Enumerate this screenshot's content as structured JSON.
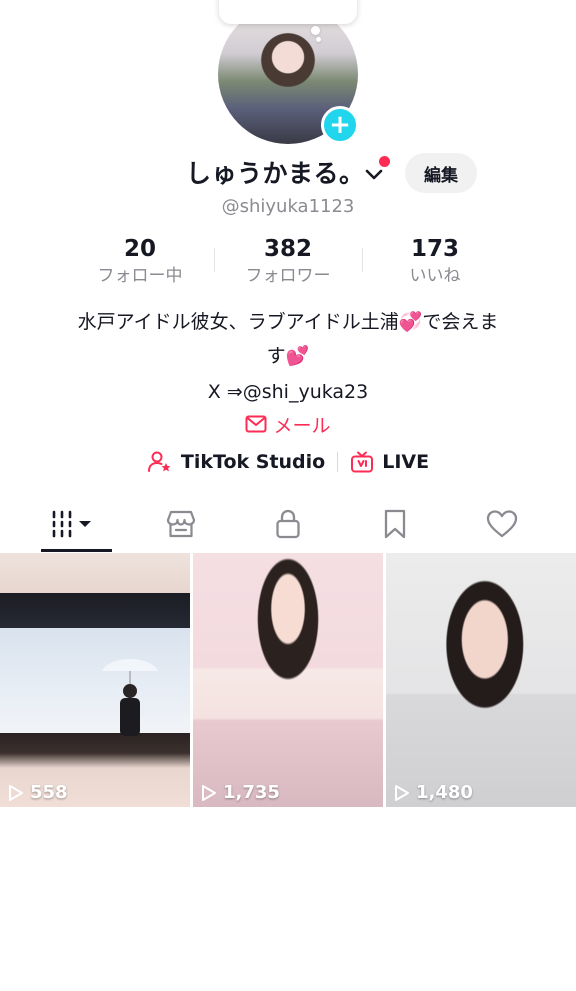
{
  "profile": {
    "display_name": "しゅうかまる。",
    "username": "@shiyuka1123",
    "edit_label": "編集"
  },
  "stats": [
    {
      "value": "20",
      "label": "フォロー中"
    },
    {
      "value": "382",
      "label": "フォロワー"
    },
    {
      "value": "173",
      "label": "いいね"
    }
  ],
  "bio": {
    "line1": "水戸アイドル彼女、ラブアイドル土浦💞で会えま",
    "line2": "す💕",
    "line3": "X ⇒@shi_yuka23"
  },
  "mail_label": "メール",
  "tools": {
    "studio_label": "TikTok Studio",
    "live_label": "LIVE"
  },
  "tabs": [
    {
      "icon": "videos-grid-icon"
    },
    {
      "icon": "shop-icon"
    },
    {
      "icon": "lock-icon"
    },
    {
      "icon": "bookmark-icon"
    },
    {
      "icon": "heart-icon"
    }
  ],
  "videos": [
    {
      "views": "558"
    },
    {
      "views": "1,735"
    },
    {
      "views": "1,480"
    }
  ],
  "colors": {
    "accent": "#fe2c55",
    "avatar_add": "#20d5ec",
    "muted_text": "#8a8b91"
  }
}
